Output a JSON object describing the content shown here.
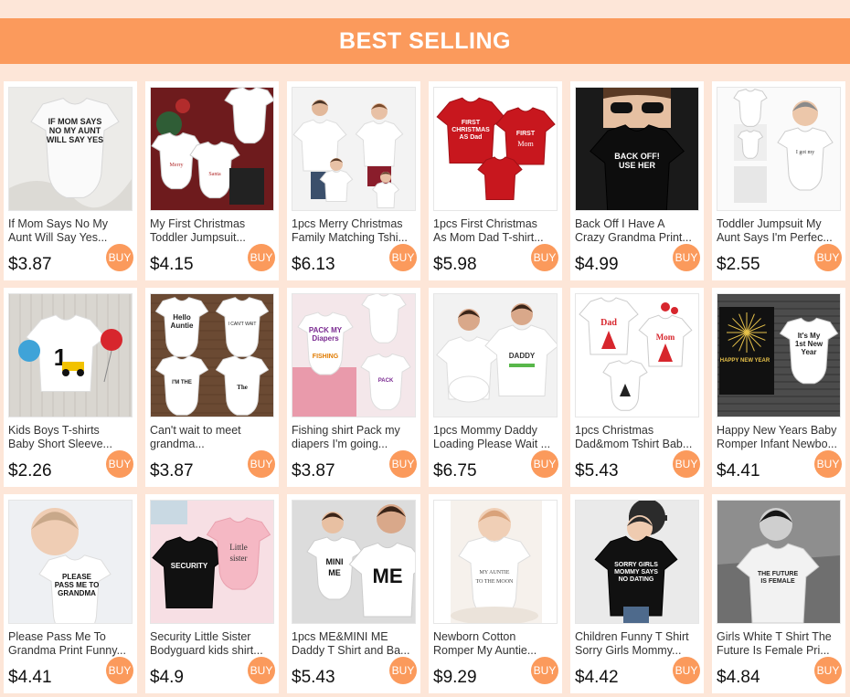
{
  "banner": {
    "title": "BEST SELLING"
  },
  "colors": {
    "accent": "#fb9a5c",
    "background": "#fde6d8"
  },
  "buy_label": "BUY",
  "products": [
    {
      "title_1": "If Mom Says No My",
      "title_2": "Aunt Will Say Yes...",
      "price": "$3.87",
      "image": "white-onesie",
      "img_text": "IF MOM SAYS NO MY AUNT WILL SAY YES"
    },
    {
      "title_1": "My First Christmas",
      "title_2": "Toddler Jumpsuit...",
      "price": "$4.15",
      "image": "christmas-onesies",
      "img_text": "Merry Christmas"
    },
    {
      "title_1": "1pcs Merry Christmas",
      "title_2": "Family Matching Tshi...",
      "price": "$6.13",
      "image": "family-photo",
      "img_text": ""
    },
    {
      "title_1": "1pcs First Christmas",
      "title_2": "As Mom Dad T-shirt...",
      "price": "$5.98",
      "image": "red-tshirts",
      "img_text": "FIRST CHRISTMAS AS Dad"
    },
    {
      "title_1": "Back Off I Have A",
      "title_2": "Crazy Grandma Print...",
      "price": "$4.99",
      "image": "black-tshirt-kid",
      "img_text": "BACK OFF! USE HER"
    },
    {
      "title_1": "Toddler Jumpsuit My",
      "title_2": "Aunt Says I'm Perfec...",
      "price": "$2.55",
      "image": "baby-collage",
      "img_text": ""
    },
    {
      "title_1": "Kids Boys T-shirts",
      "title_2": "Baby Short Sleeve...",
      "price": "$2.26",
      "image": "birthday-tshirt",
      "img_text": "1"
    },
    {
      "title_1": "Can't wait to meet",
      "title_2": "grandma...",
      "price": "$3.87",
      "image": "onesie-grid",
      "img_text": "Hello Auntie"
    },
    {
      "title_1": "Fishing shirt Pack my",
      "title_2": "diapers I'm going...",
      "price": "$3.87",
      "image": "fishing-onesies",
      "img_text": "PACK MY Diapers"
    },
    {
      "title_1": "1pcs Mommy Daddy",
      "title_2": "Loading Please Wait ...",
      "price": "$6.75",
      "image": "couple-photo",
      "img_text": "DADDY"
    },
    {
      "title_1": "1pcs Christmas",
      "title_2": "Dad&mom Tshirt Bab...",
      "price": "$5.43",
      "image": "christmas-family-tees",
      "img_text": "Dad Mom"
    },
    {
      "title_1": "Happy New Years Baby",
      "title_2": "Romper Infant Newbo...",
      "price": "$4.41",
      "image": "new-year-romper",
      "img_text": "It's My 1st New Year"
    },
    {
      "title_1": "Please Pass Me To",
      "title_2": "Grandma Print Funny...",
      "price": "$4.41",
      "image": "baby-grandma",
      "img_text": "PLEASE PASS ME TO GRANDMA"
    },
    {
      "title_1": "Security Little Sister",
      "title_2": "Bodyguard kids shirt...",
      "price": "$4.9",
      "image": "sister-tees",
      "img_text": "SECURITY Little sister"
    },
    {
      "title_1": "1pcs ME&MINI ME",
      "title_2": "Daddy T Shirt and Ba...",
      "price": "$5.43",
      "image": "mini-me",
      "img_text": "MINI ME ME"
    },
    {
      "title_1": "Newborn Cotton",
      "title_2": "Romper My Auntie...",
      "price": "$9.29",
      "image": "newborn-romper",
      "img_text": ""
    },
    {
      "title_1": "Children Funny T Shirt",
      "title_2": "Sorry Girls Mommy...",
      "price": "$4.42",
      "image": "sorry-girls",
      "img_text": "SORRY GIRLS MOMMY SAYS NO DATING"
    },
    {
      "title_1": "Girls White T Shirt The",
      "title_2": "Future Is Female Pri...",
      "price": "$4.84",
      "image": "future-female",
      "img_text": "THE FUTURE IS FEMALE"
    }
  ]
}
